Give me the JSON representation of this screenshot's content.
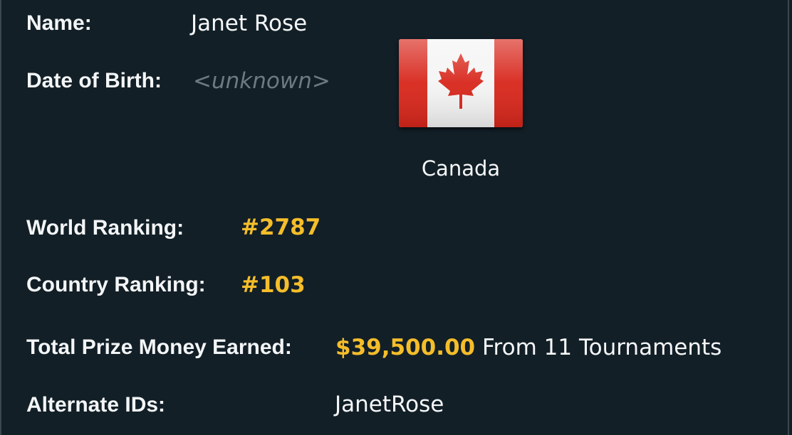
{
  "profile": {
    "name_label": "Name:",
    "name_value": "Janet Rose",
    "dob_label": "Date of Birth:",
    "dob_value": "<unknown>",
    "country": "Canada",
    "country_flag_icon": "canada-flag-icon",
    "world_ranking_label": "World Ranking:",
    "world_ranking_value": "#2787",
    "country_ranking_label": "Country Ranking:",
    "country_ranking_value": "#103",
    "prize_label": "Total Prize Money Earned:",
    "prize_value": "$39,500.00",
    "prize_suffix": "From 11 Tournaments",
    "alt_ids_label": "Alternate IDs:",
    "alt_ids_value": "JanetRose"
  },
  "colors": {
    "background": "#121f27",
    "highlight": "#f5bd2a",
    "muted": "#6d7a82",
    "flag_red": "#d8261b"
  }
}
